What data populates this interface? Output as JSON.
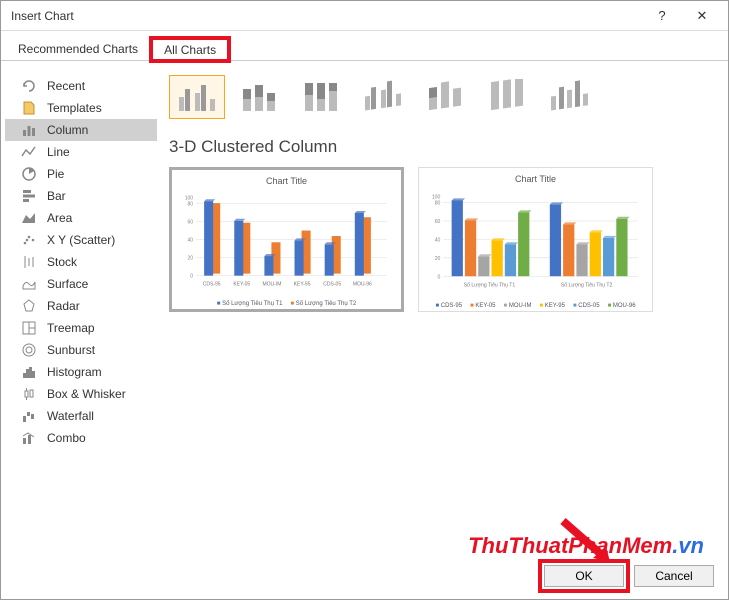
{
  "window": {
    "title": "Insert Chart"
  },
  "tabs": {
    "recommended": "Recommended Charts",
    "all": "All Charts"
  },
  "sidebar": {
    "items": [
      {
        "label": "Recent"
      },
      {
        "label": "Templates"
      },
      {
        "label": "Column"
      },
      {
        "label": "Line"
      },
      {
        "label": "Pie"
      },
      {
        "label": "Bar"
      },
      {
        "label": "Area"
      },
      {
        "label": "X Y (Scatter)"
      },
      {
        "label": "Stock"
      },
      {
        "label": "Surface"
      },
      {
        "label": "Radar"
      },
      {
        "label": "Treemap"
      },
      {
        "label": "Sunburst"
      },
      {
        "label": "Histogram"
      },
      {
        "label": "Box & Whisker"
      },
      {
        "label": "Waterfall"
      },
      {
        "label": "Combo"
      }
    ],
    "selected_index": 2
  },
  "subtype_name": "3-D Clustered Column",
  "preview1": {
    "title": "Chart Title",
    "legend": {
      "a": "Số Lượng Tiêu Thụ T1",
      "b": "Số Lượng Tiêu Thụ T2"
    }
  },
  "preview2": {
    "title": "Chart Title",
    "group_labels": {
      "a": "Số Lượng Tiêu Thụ T1",
      "b": "Số Lượng Tiêu Thụ T2"
    },
    "legend": {
      "a": "CDS-95",
      "b": "KEY-05",
      "c": "MOU-IM",
      "d": "KEY-95",
      "e": "CDS-05",
      "f": "MOU-96"
    }
  },
  "chart_data": {
    "type": "bar",
    "subtype": "3d-clustered",
    "title": "Chart Title",
    "ylim": [
      0,
      100
    ],
    "categories": [
      "CDS-95",
      "KEY-05",
      "MOU-IM",
      "KEY-95",
      "CDS-05",
      "MOU-96"
    ],
    "series": [
      {
        "name": "Số Lượng Tiêu Thụ T1",
        "values": [
          95,
          70,
          25,
          45,
          40,
          80
        ]
      },
      {
        "name": "Số Lượng Tiêu Thụ T2",
        "values": [
          90,
          65,
          40,
          55,
          48,
          72
        ]
      }
    ],
    "colors": {
      "series1": "#4472c4",
      "series2": "#ed7d31"
    }
  },
  "buttons": {
    "ok": "OK",
    "cancel": "Cancel"
  },
  "watermark": {
    "a": "ThuThuatPhanMem",
    "b": ".vn"
  }
}
